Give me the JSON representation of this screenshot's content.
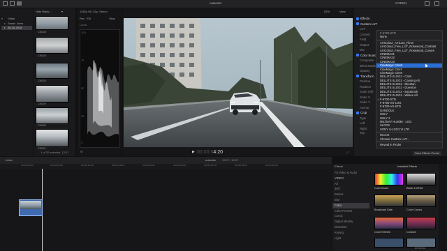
{
  "toolbar": {
    "project_title": "oulander",
    "right_label": "CODEN"
  },
  "library": {
    "items": [
      {
        "label": "Video"
      },
      {
        "label": "Smart...tions"
      },
      {
        "label": "26-10-2018"
      }
    ]
  },
  "browser": {
    "header_label": "Hide Rejec...",
    "clips": [
      {
        "label": "C0028"
      },
      {
        "label": "C0025"
      },
      {
        "label": "C0026"
      },
      {
        "label": "C0029"
      },
      {
        "label": "C0030"
      },
      {
        "label": "C0031"
      }
    ],
    "footer": "1 of 20 selected, 12:07"
  },
  "scopes": {
    "title": "1080p HD 25p, Stereo",
    "mode": "Rec. 709",
    "view_label": "View",
    "luma_label": "Luma",
    "scale": [
      "100",
      "75",
      "50",
      "25",
      "0"
    ]
  },
  "viewer": {
    "zoom": "52%",
    "view_label": "View",
    "timecode": "00:00:04:20",
    "timecode_dim": "00:00:0",
    "timecode_bright": "4:20"
  },
  "inspector": {
    "sections": [
      {
        "label": "Effects"
      },
      {
        "label": "Custom LUT"
      },
      {
        "label": "LUT"
      },
      {
        "label": "Convert"
      },
      {
        "label": "Field"
      },
      {
        "label": "Output"
      },
      {
        "label": "Mix"
      },
      {
        "label": "Color Board"
      },
      {
        "label": "Composite"
      },
      {
        "label": "Blend Mode"
      },
      {
        "label": "Opacity"
      },
      {
        "label": "Transform"
      },
      {
        "label": "Position"
      },
      {
        "label": "Rotation"
      },
      {
        "label": "Scale (All)"
      },
      {
        "label": "Scale X"
      },
      {
        "label": "Scale Y"
      },
      {
        "label": "Anchor"
      },
      {
        "label": "Crop"
      },
      {
        "label": "Type"
      },
      {
        "label": "Left"
      },
      {
        "label": "Right"
      },
      {
        "label": "Top"
      }
    ],
    "save_preset": "Save Effects Preset"
  },
  "lut_menu": {
    "items": [
      {
        "label": "None",
        "type": "item"
      },
      {
        "label": "",
        "type": "sep"
      },
      {
        "label": "ArriColour_ArriLuts_Films",
        "type": "item"
      },
      {
        "label": "ArriColour_Free_LUT_Rosewood_Contrast",
        "type": "item"
      },
      {
        "label": "ArriColour_Free_LUT_Rosewood_Curves",
        "type": "item"
      },
      {
        "label": "CINEMA21",
        "type": "item"
      },
      {
        "label": "CINEMA22",
        "type": "item"
      },
      {
        "label": "CINEMA23",
        "type": "item"
      },
      {
        "label": "CineMagic Cine8",
        "type": "hl"
      },
      {
        "label": "CineMagic Cine7",
        "type": "item"
      },
      {
        "label": "CineMagic Cine8",
        "type": "item"
      },
      {
        "label": "DELUTS SLOG2 - Calm",
        "type": "item"
      },
      {
        "label": "DELUTS SLOG2 - Canning Alt",
        "type": "item"
      },
      {
        "label": "DELUTS SLOG2 - Dkestan",
        "type": "item"
      },
      {
        "label": "DELUTS SLOG2 - Downton",
        "type": "item"
      },
      {
        "label": "DELUTS SLOG2 - Eastbrook",
        "type": "item"
      },
      {
        "label": "DELUTS SLOG2 - Wilsee Alt",
        "type": "item"
      },
      {
        "label": "F-8700-STD",
        "type": "check"
      },
      {
        "label": "F-8700-VS-LOG",
        "type": "item"
      },
      {
        "label": "F-8700-VS-STD",
        "type": "item"
      },
      {
        "label": "GANDOLK",
        "type": "item"
      },
      {
        "label": "HOLY",
        "type": "item"
      },
      {
        "label": "HOLY 2",
        "type": "item"
      },
      {
        "label": "MILTBAY Humble - LOG",
        "type": "item"
      },
      {
        "label": "SLOG2",
        "type": "item"
      },
      {
        "label": "SONY S-LOG3 VI LTR",
        "type": "item"
      },
      {
        "label": "",
        "type": "sep"
      },
      {
        "label": "Recent",
        "type": "item"
      },
      {
        "label": "Choose Custom LUT...",
        "type": "item"
      },
      {
        "label": "",
        "type": "sep"
      },
      {
        "label": "Reveal in Finder",
        "type": "item"
      }
    ],
    "current_value": "F-8700-STD"
  },
  "timeline": {
    "index_label": "Index",
    "project_name": "oulander",
    "duration": "12:07 / 12:07",
    "ruler": [
      "00:00:00:00",
      "00:00:05:00",
      "00:00:10:00",
      "00:00:15:00",
      "00:00:20:00",
      "00:00:25:00",
      "00:00:30:00",
      "00:00:35:00",
      "00:00:40:00"
    ]
  },
  "effects_browser": {
    "title": "Effects",
    "installed_label": "Installed Effects",
    "categories": [
      {
        "label": "All Video & Audio"
      },
      {
        "label": "VIDEO"
      },
      {
        "label": "All"
      },
      {
        "label": "360°"
      },
      {
        "label": "Basics"
      },
      {
        "label": "Blur"
      },
      {
        "label": "Color"
      },
      {
        "label": "Color Presets"
      },
      {
        "label": "Comic"
      },
      {
        "label": "Digital Identity"
      },
      {
        "label": "Distortion"
      },
      {
        "label": "Keying"
      },
      {
        "label": "Light"
      }
    ],
    "selected_category": "Color",
    "effects": [
      {
        "label": "Color Board"
      },
      {
        "label": "Black & White"
      },
      {
        "label": "Broadcast Safe"
      },
      {
        "label": "Color Curves"
      },
      {
        "label": "Color Wheels"
      },
      {
        "label": "Colorize"
      }
    ],
    "count": "22 items"
  },
  "colors": {
    "accent": "#2a6fd6",
    "panel": "#1b1b1d",
    "clip": "#3f6ab0"
  }
}
